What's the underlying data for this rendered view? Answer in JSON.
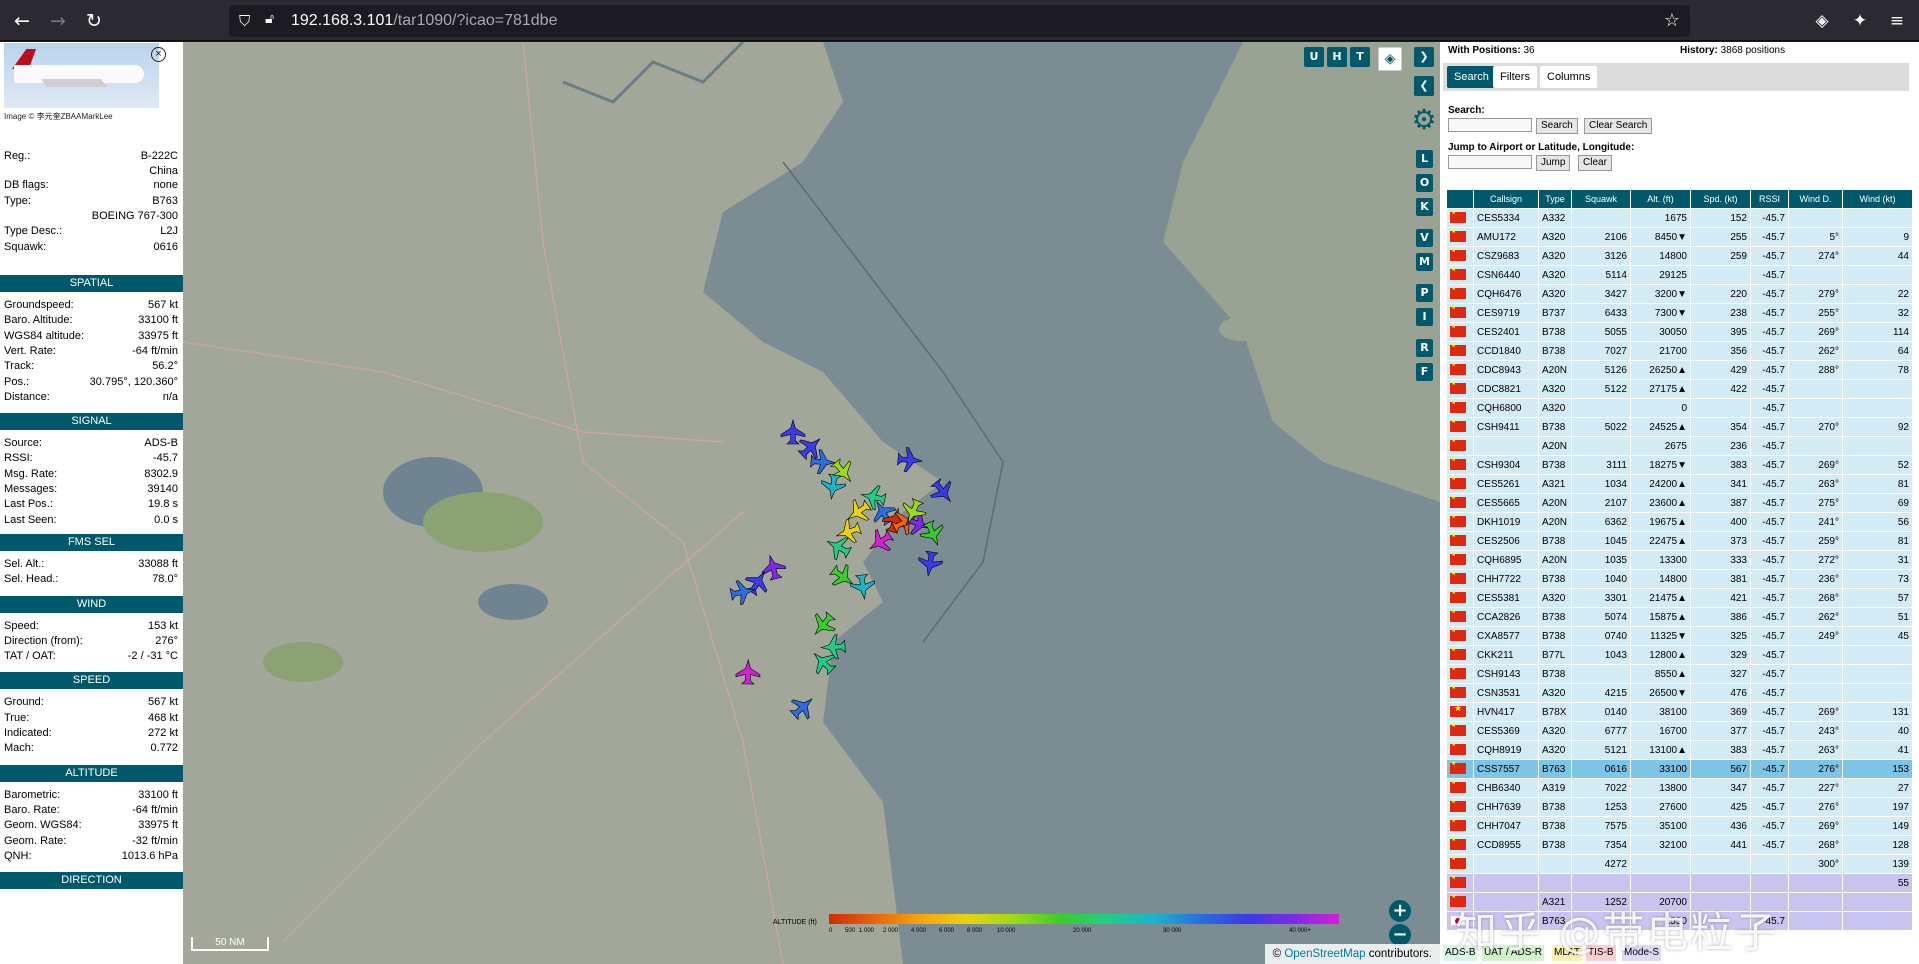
{
  "browser": {
    "url_host": "192.168.3.101",
    "url_path": "/tar1090/?icao=781dbe"
  },
  "info": {
    "photo_credit": "Image © 李元奎ZBAAMarkLee",
    "rows_top": [
      [
        "Reg.:",
        "B-222C"
      ],
      [
        "",
        "China"
      ],
      [
        "DB flags:",
        "none"
      ],
      [
        "Type:",
        "B763"
      ],
      [
        "",
        "BOEING 767-300"
      ],
      [
        "Type Desc.:",
        "L2J"
      ],
      [
        "Squawk:",
        "0616"
      ]
    ],
    "sections": [
      {
        "title": "SPATIAL",
        "rows": [
          [
            "Groundspeed:",
            "567 kt"
          ],
          [
            "Baro. Altitude:",
            "33100 ft"
          ],
          [
            "WGS84 altitude:",
            "33975 ft"
          ],
          [
            "Vert. Rate:",
            "-64 ft/min"
          ],
          [
            "Track:",
            "56.2°"
          ],
          [
            "Pos.:",
            "30.795°, 120.360°"
          ],
          [
            "Distance:",
            "n/a"
          ]
        ]
      },
      {
        "title": "SIGNAL",
        "rows": [
          [
            "Source:",
            "ADS-B"
          ],
          [
            "RSSI:",
            "-45.7"
          ],
          [
            "Msg. Rate:",
            "8302.9"
          ],
          [
            "Messages:",
            "39140"
          ],
          [
            "Last Pos.:",
            "19.8 s"
          ],
          [
            "Last Seen:",
            "0.0 s"
          ]
        ]
      },
      {
        "title": "FMS SEL",
        "rows": [
          [
            "Sel. Alt.:",
            "33088 ft"
          ],
          [
            "Sel. Head.:",
            "78.0°"
          ]
        ]
      },
      {
        "title": "WIND",
        "rows": [
          [
            "Speed:",
            "153 kt"
          ],
          [
            "Direction (from):",
            "276°"
          ],
          [
            "TAT / OAT:",
            "-2 / -31 °C"
          ]
        ]
      },
      {
        "title": "SPEED",
        "rows": [
          [
            "Ground:",
            "567 kt"
          ],
          [
            "True:",
            "468 kt"
          ],
          [
            "Indicated:",
            "272 kt"
          ],
          [
            "Mach:",
            "0.772"
          ]
        ]
      },
      {
        "title": "ALTITUDE",
        "rows": [
          [
            "Barometric:",
            "33100 ft"
          ],
          [
            "Baro. Rate:",
            "-64 ft/min"
          ],
          [
            "Geom. WGS84:",
            "33975 ft"
          ],
          [
            "Geom. Rate:",
            "-32 ft/min"
          ],
          [
            "QNH:",
            "1013.6 hPa"
          ]
        ]
      },
      {
        "title": "DIRECTION",
        "rows": []
      }
    ]
  },
  "map": {
    "top_buttons": [
      "U",
      "H",
      "T"
    ],
    "side_buttons": [
      "L",
      "O",
      "K",
      "V",
      "M",
      "P",
      "I",
      "R",
      "F"
    ],
    "scale_label": "50 NM",
    "attribution_prefix": "© ",
    "attribution_link": "OpenStreetMap",
    "attribution_suffix": " contributors.",
    "altitude_label": "ALTITUDE (ft)",
    "altitude_ticks": [
      "0",
      "500",
      "1 000",
      "2 000",
      "4 000",
      "6 000",
      "8 000",
      "10 000",
      "20 000",
      "30 000",
      "40 000+"
    ],
    "zoom_in": "+",
    "zoom_out": "−",
    "watermark": "知乎 @带电粒子"
  },
  "right": {
    "with_positions_label": "With Positions:",
    "with_positions_value": "36",
    "history_label": "History:",
    "history_value": "3868 positions",
    "tabs": [
      "Search",
      "Filters",
      "Columns"
    ],
    "search_label": "Search:",
    "search_button": "Search",
    "clear_search_button": "Clear Search",
    "jump_label": "Jump to Airport or Latitude, Longitude:",
    "jump_button": "Jump",
    "clear_button": "Clear",
    "columns": [
      "",
      "Callsign",
      "Type",
      "Squawk",
      "Alt. (ft)",
      "Spd. (kt)",
      "RSSI",
      "Wind D.",
      "Wind (kt)"
    ],
    "rows": [
      [
        "cn",
        "CES5334",
        "A332",
        "",
        "1675",
        "152",
        "-45.7",
        "",
        ""
      ],
      [
        "cn",
        "AMU172",
        "A320",
        "2106",
        "8450▼",
        "255",
        "-45.7",
        "5°",
        "9"
      ],
      [
        "cn",
        "CSZ9683",
        "A320",
        "3126",
        "14800",
        "259",
        "-45.7",
        "274°",
        "44"
      ],
      [
        "cn",
        "CSN6440",
        "A320",
        "5114",
        "29125",
        "",
        "-45.7",
        "",
        ""
      ],
      [
        "cn",
        "CQH6476",
        "A320",
        "3427",
        "3200▼",
        "220",
        "-45.7",
        "279°",
        "22"
      ],
      [
        "cn",
        "CES9719",
        "B737",
        "6433",
        "7300▼",
        "238",
        "-45.7",
        "255°",
        "32"
      ],
      [
        "cn",
        "CES2401",
        "B738",
        "5055",
        "30050",
        "395",
        "-45.7",
        "269°",
        "114"
      ],
      [
        "cn",
        "CCD1840",
        "B738",
        "7027",
        "21700",
        "356",
        "-45.7",
        "262°",
        "64"
      ],
      [
        "cn",
        "CDC8943",
        "A20N",
        "5126",
        "26250▲",
        "429",
        "-45.7",
        "288°",
        "78"
      ],
      [
        "cn",
        "CDC8821",
        "A320",
        "5122",
        "27175▲",
        "422",
        "-45.7",
        "",
        ""
      ],
      [
        "cn",
        "CQH6800",
        "A320",
        "",
        "0",
        "",
        "-45.7",
        "",
        ""
      ],
      [
        "cn",
        "CSH9411",
        "B738",
        "5022",
        "24525▲",
        "354",
        "-45.7",
        "270°",
        "92"
      ],
      [
        "cn",
        "",
        "A20N",
        "",
        "2675",
        "236",
        "-45.7",
        "",
        ""
      ],
      [
        "cn",
        "CSH9304",
        "B738",
        "3111",
        "18275▼",
        "383",
        "-45.7",
        "269°",
        "52"
      ],
      [
        "cn",
        "CES5261",
        "A321",
        "1034",
        "24200▲",
        "341",
        "-45.7",
        "263°",
        "81"
      ],
      [
        "cn",
        "CES5665",
        "A20N",
        "2107",
        "23600▲",
        "387",
        "-45.7",
        "275°",
        "69"
      ],
      [
        "cn",
        "DKH1019",
        "A20N",
        "6362",
        "19675▲",
        "400",
        "-45.7",
        "241°",
        "56"
      ],
      [
        "cn",
        "CES2506",
        "B738",
        "1045",
        "22475▲",
        "373",
        "-45.7",
        "259°",
        "81"
      ],
      [
        "cn",
        "CQH6895",
        "A20N",
        "1035",
        "13300",
        "333",
        "-45.7",
        "272°",
        "31"
      ],
      [
        "cn",
        "CHH7722",
        "B738",
        "1040",
        "14800",
        "381",
        "-45.7",
        "236°",
        "73"
      ],
      [
        "cn",
        "CES5381",
        "A320",
        "3301",
        "21475▲",
        "421",
        "-45.7",
        "268°",
        "57"
      ],
      [
        "cn",
        "CCA2826",
        "B738",
        "5074",
        "15875▲",
        "386",
        "-45.7",
        "262°",
        "51"
      ],
      [
        "cn",
        "CXA8577",
        "B738",
        "0740",
        "11325▼",
        "325",
        "-45.7",
        "249°",
        "45"
      ],
      [
        "cn",
        "CKK211",
        "B77L",
        "1043",
        "12800▲",
        "329",
        "-45.7",
        "",
        ""
      ],
      [
        "cn",
        "CSH9143",
        "B738",
        "",
        "8550▲",
        "327",
        "-45.7",
        "",
        ""
      ],
      [
        "cn",
        "CSN3531",
        "A320",
        "4215",
        "26500▼",
        "476",
        "-45.7",
        "",
        ""
      ],
      [
        "vn",
        "HVN417",
        "B78X",
        "0140",
        "38100",
        "369",
        "-45.7",
        "269°",
        "131"
      ],
      [
        "cn",
        "CES5369",
        "A320",
        "6777",
        "16700",
        "377",
        "-45.7",
        "243°",
        "40"
      ],
      [
        "cn",
        "CQH8919",
        "A320",
        "5121",
        "13100▲",
        "383",
        "-45.7",
        "263°",
        "41"
      ],
      [
        "cn",
        "CSS7557",
        "B763",
        "0616",
        "33100",
        "567",
        "-45.7",
        "276°",
        "153"
      ],
      [
        "cn",
        "CHB6340",
        "A319",
        "7022",
        "13800",
        "347",
        "-45.7",
        "227°",
        "27"
      ],
      [
        "cn",
        "CHH7639",
        "B738",
        "1253",
        "27600",
        "425",
        "-45.7",
        "276°",
        "197"
      ],
      [
        "cn",
        "CHH7047",
        "B738",
        "7575",
        "35100",
        "436",
        "-45.7",
        "269°",
        "149"
      ],
      [
        "cn",
        "CCD8955",
        "B738",
        "7354",
        "32100",
        "441",
        "-45.7",
        "268°",
        "128"
      ],
      [
        "cn",
        "",
        "",
        "4272",
        "",
        "",
        "",
        "300°",
        "139"
      ],
      [
        "cn",
        "",
        "",
        "",
        "",
        "",
        "",
        "",
        "55"
      ],
      [
        "cn",
        "",
        "A321",
        "1252",
        "20700",
        "",
        "",
        "",
        ""
      ],
      [
        "jp",
        "",
        "B763",
        "",
        "1550",
        "",
        "-45.7",
        "",
        ""
      ]
    ],
    "legend": [
      "ADS-B",
      "UAT / ADS-R",
      "MLAT",
      "TIS-B",
      "Mode-S"
    ],
    "legend_colors": [
      "#d7f7e7",
      "#cff5c8",
      "#fcf1b4",
      "#fccfd0",
      "#ddd8f5"
    ]
  }
}
